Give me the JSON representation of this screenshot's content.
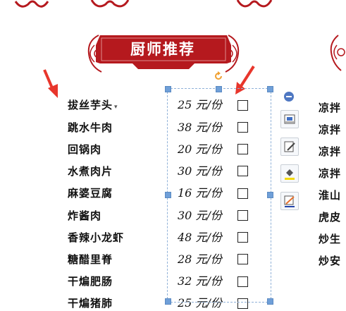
{
  "banner": {
    "title": "厨师推荐"
  },
  "menu": {
    "dishes": [
      "拔丝芋头",
      "跳水牛肉",
      "回锅肉",
      "水煮肉片",
      "麻婆豆腐",
      "炸酱肉",
      "香辣小龙虾",
      "糖醋里脊",
      "干煸肥肠",
      "干煸猪肺"
    ],
    "prices": [
      "25 元/份",
      "38 元/份",
      "20 元/份",
      "30 元/份",
      "16 元/份",
      "30 元/份",
      "48 元/份",
      "28 元/份",
      "32 元/份",
      "25 元/份"
    ]
  },
  "right_column": {
    "dishes": [
      "凉拌",
      "凉拌",
      "凉拌",
      "凉拌",
      "淮山",
      "虎皮",
      "炒生",
      "炒安"
    ]
  },
  "toolbar": {
    "icons": [
      "collapse-icon",
      "layout-options-icon",
      "edit-shape-icon",
      "fill-color-icon",
      "line-color-icon"
    ]
  },
  "colors": {
    "banner_red": "#b5191e",
    "arrow_red": "#e8362c",
    "selection": "#6f9fd8",
    "rotate": "#f0a030"
  }
}
